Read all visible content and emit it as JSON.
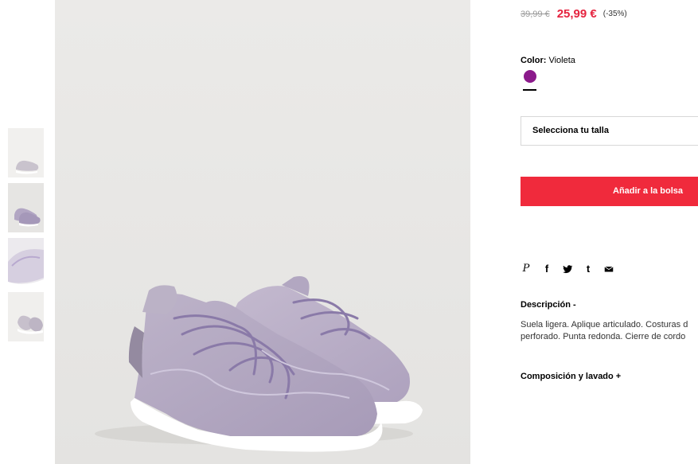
{
  "thumbnails": [
    {
      "name": "thumbnail-1"
    },
    {
      "name": "thumbnail-2"
    },
    {
      "name": "thumbnail-3"
    },
    {
      "name": "thumbnail-4"
    }
  ],
  "price": {
    "old": "39,99 €",
    "new": "25,99 €",
    "discount": "(-35%)"
  },
  "color": {
    "label": "Color:",
    "value": "Violeta",
    "swatch": "#8b1a8b"
  },
  "size_select": {
    "label": "Selecciona tu talla"
  },
  "add_to_bag": {
    "label": "Añadir a la bolsa",
    "bg": "#f02a3c"
  },
  "share": {
    "icons": [
      "pinterest-icon",
      "facebook-icon",
      "twitter-icon",
      "tumblr-icon",
      "email-icon"
    ],
    "pinterest": "P",
    "facebook": "f",
    "tumblr": "t"
  },
  "description": {
    "title": "Descripción -",
    "line1": "Suela ligera. Aplique articulado. Costuras d",
    "line2": "perforado. Punta redonda. Cierre de cordo"
  },
  "composition": {
    "title": "Composición y lavado +"
  }
}
